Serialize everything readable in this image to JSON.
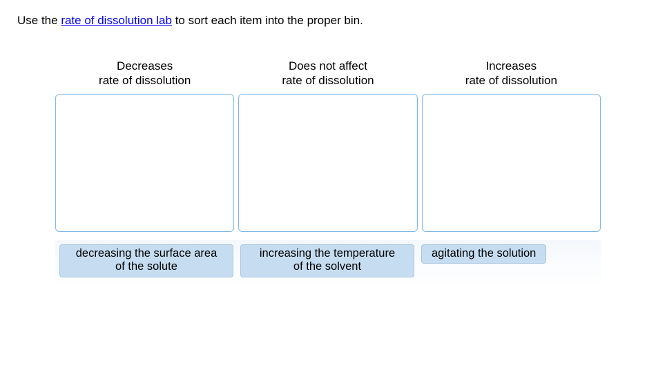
{
  "instruction": {
    "prefix": "Use the ",
    "link_text": "rate of dissolution lab",
    "suffix": " to sort each item into the proper bin."
  },
  "bins": [
    {
      "line1": "Decreases",
      "line2": "rate of dissolution"
    },
    {
      "line1": "Does not affect",
      "line2": "rate of dissolution"
    },
    {
      "line1": "Increases",
      "line2": "rate of dissolution"
    }
  ],
  "items": [
    {
      "line1": "decreasing the surface area",
      "line2": "of the solute",
      "multi": true
    },
    {
      "line1": "increasing the temperature",
      "line2": "of the solvent",
      "multi": true
    },
    {
      "line1": "agitating the solution",
      "line2": "",
      "multi": false
    }
  ]
}
